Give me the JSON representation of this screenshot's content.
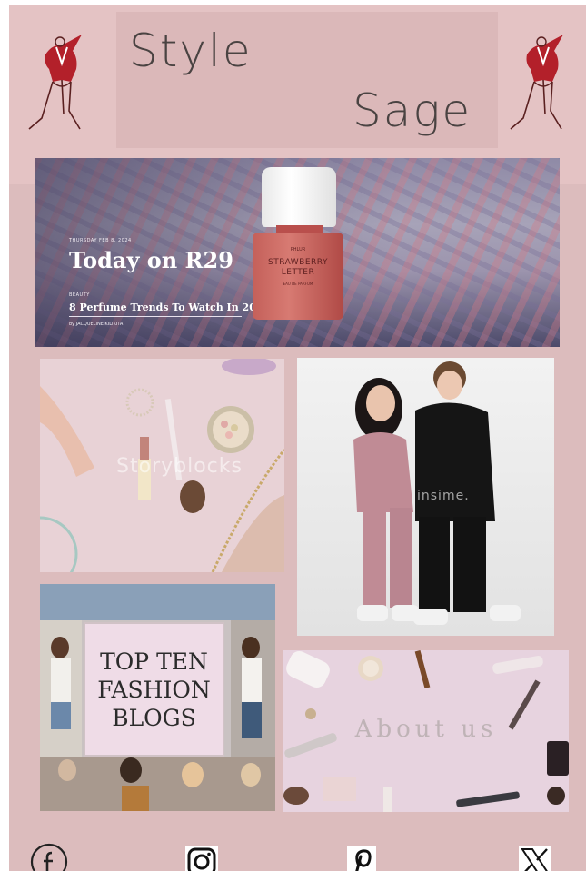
{
  "header": {
    "title_line1": "Style",
    "title_line2": "Sage"
  },
  "hero": {
    "date": "THURSDAY FEB 8, 2024",
    "heading": "Today on R29",
    "category": "BEAUTY",
    "article_title": "8 Perfume Trends To Watch In 2024",
    "byline": "by JACQUELINE KILIKITA",
    "bottle_brand": "PHLUR",
    "bottle_name_line1": "STRAWBERRY",
    "bottle_name_line2": "LETTER",
    "bottle_sub": "EAU DE PARFUM"
  },
  "tiles": {
    "beauty_watermark": "Storyblocks",
    "kids_watermark": "insime.",
    "blogs_line1": "TOP TEN",
    "blogs_line2": "FASHION",
    "blogs_line3": "BLOGS",
    "about_label": "About us"
  },
  "colors": {
    "page_bg": "#dcbcbd",
    "title_text": "#4a4342",
    "logo_red": "#b3202a"
  },
  "social": [
    {
      "name": "facebook-icon"
    },
    {
      "name": "instagram-icon"
    },
    {
      "name": "pinterest-icon"
    },
    {
      "name": "x-icon"
    }
  ]
}
